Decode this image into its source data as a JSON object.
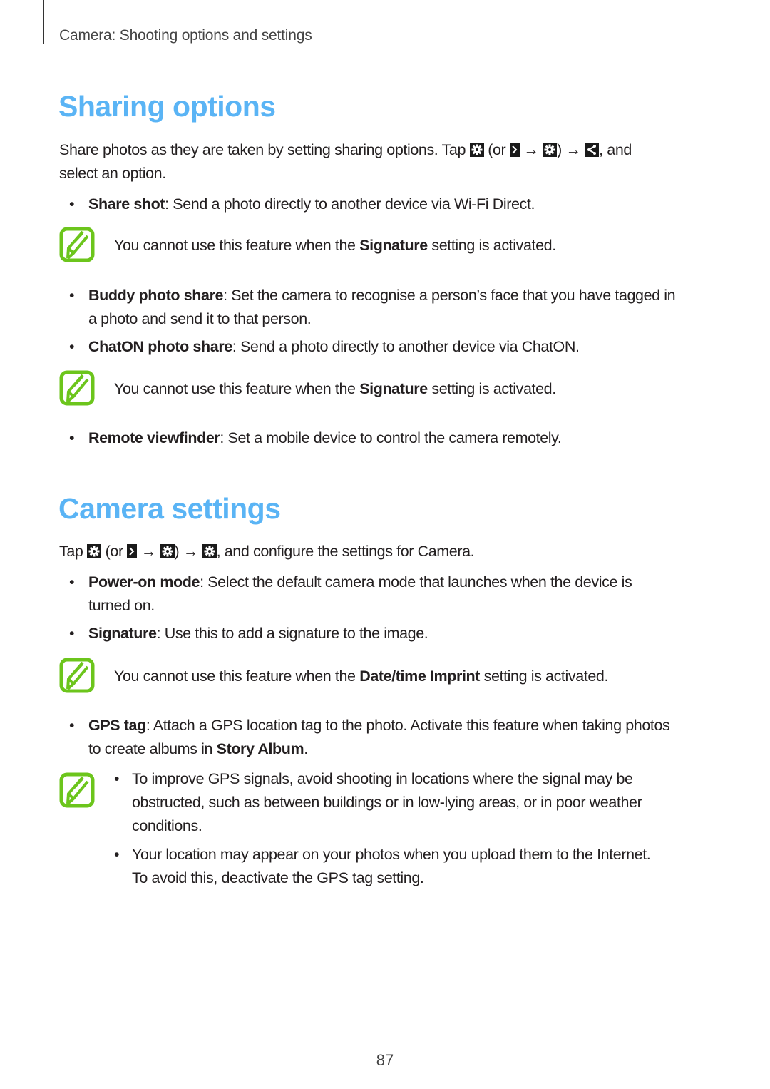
{
  "running_head": "Camera: Shooting options and settings",
  "sections": {
    "sharing": {
      "title": "Sharing options",
      "intro": {
        "pre": "Share photos as they are taken by setting sharing options. Tap",
        "or": "(or",
        "arrow1": "→",
        "close": ")",
        "arrow2": "→",
        "post": ", and",
        "line2": "select an option."
      },
      "items": [
        {
          "term": "Share shot",
          "text": ": Send a photo directly to another device via Wi-Fi Direct."
        },
        {
          "term": "Buddy photo share",
          "text": ": Set the camera to recognise a person’s face that you have tagged in",
          "text2": "a photo and send it to that person."
        },
        {
          "term": "ChatON photo share",
          "text": ": Send a photo directly to another device via ChatON."
        },
        {
          "term": "Remote viewfinder",
          "text": ": Set a mobile device to control the camera remotely."
        }
      ],
      "notes": [
        {
          "pre": "You cannot use this feature when the ",
          "bold": "Signature",
          "post": " setting is activated."
        },
        {
          "pre": "You cannot use this feature when the ",
          "bold": "Signature",
          "post": " setting is activated."
        }
      ]
    },
    "camera": {
      "title": "Camera settings",
      "intro": {
        "pre": "Tap",
        "or": "(or",
        "arrow1": "→",
        "close": ")",
        "arrow2": "→",
        "post": ", and configure the settings for Camera."
      },
      "items": [
        {
          "term": "Power-on mode",
          "text": ": Select the default camera mode that launches when the device is",
          "text2": "turned on."
        },
        {
          "term": "Signature",
          "text": ": Use this to add a signature to the image."
        },
        {
          "term": "GPS tag",
          "text": ": Attach a GPS location tag to the photo. Activate this feature when taking photos",
          "text2_pre": "to create albums in ",
          "text2_bold": "Story Album",
          "text2_post": "."
        }
      ],
      "notes": [
        {
          "pre": "You cannot use this feature when the ",
          "bold": "Date/time Imprint",
          "post": " setting is activated."
        }
      ],
      "gps_note_bullets": [
        {
          "line1": "To improve GPS signals, avoid shooting in locations where the signal may be",
          "line2": "obstructed, such as between buildings or in low-lying areas, or in poor weather",
          "line3": "conditions."
        },
        {
          "line1": "Your location may appear on your photos when you upload them to the Internet.",
          "line2": "To avoid this, deactivate the GPS tag setting."
        }
      ]
    }
  },
  "bullet_glyph": "•",
  "icons": {
    "settings": "gear-icon",
    "more": "chevron-right-icon",
    "share": "share-icon",
    "note": "note-pencil-icon"
  },
  "colors": {
    "heading": "#5ab4f5",
    "note_icon": "#6cc51c"
  },
  "page_number": "87"
}
